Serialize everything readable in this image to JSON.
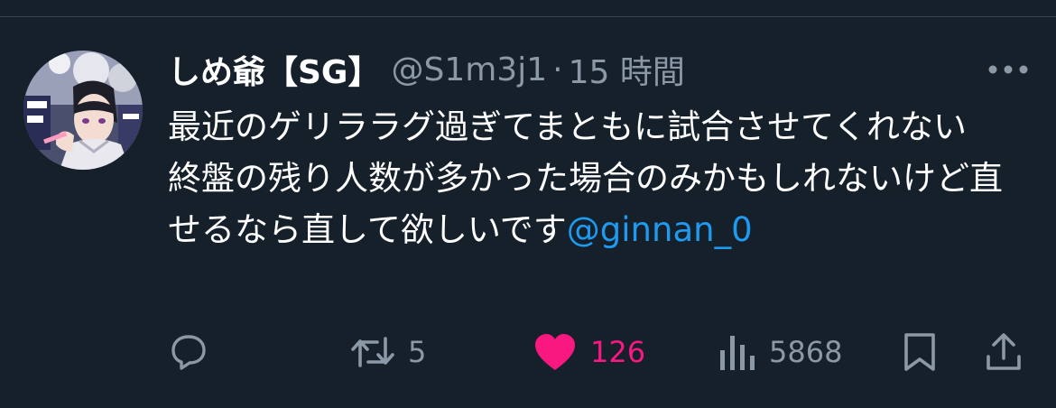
{
  "tweet": {
    "author": {
      "display_name": "しめ爺【SG】",
      "handle": "@S1m3j1",
      "avatar_icon": "anime-character-avatar"
    },
    "separator": "·",
    "timestamp": "15 時間",
    "text_line1": "最近のゲリララグ過ぎてまともに試合させてくれない",
    "text_line2": "終盤の残り人数が多かった場合のみかもしれないけど直せるなら直して欲しいです",
    "mention": "@ginnan_0"
  },
  "actions": {
    "reply": {
      "icon": "reply-icon"
    },
    "retweet": {
      "icon": "retweet-icon",
      "count": "5"
    },
    "like": {
      "icon": "heart-icon",
      "count": "126",
      "liked": true,
      "color": "#f91880"
    },
    "views": {
      "icon": "views-icon",
      "count": "5868"
    },
    "bookmark": {
      "icon": "bookmark-icon"
    },
    "share": {
      "icon": "share-icon"
    }
  },
  "colors": {
    "background": "#15202b",
    "text": "#ffffff",
    "secondary": "#8b98a5",
    "link": "#1d9bf0",
    "like": "#f91880"
  }
}
